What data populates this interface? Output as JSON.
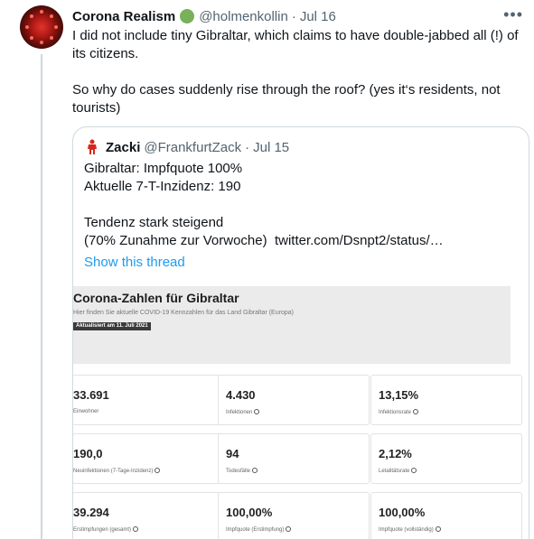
{
  "tweet": {
    "author_name": "Corona Realism",
    "handle": "@holmenkollin",
    "separator": "·",
    "date": "Jul 16",
    "more_icon": "more-icon",
    "paragraph1": "I did not include tiny Gibraltar, which claims to have double-jabbed all (!) of its citizens.",
    "paragraph2": "So why do cases suddenly rise through the roof? (yes it‘s residents, not tourists)"
  },
  "quote": {
    "author_name": "Zacki",
    "handle": "@FrankfurtZack",
    "separator": "·",
    "date": "Jul 15",
    "line1": "Gibraltar: Impfquote 100%",
    "line2": "Aktuelle 7-T-Inzidenz: 190",
    "line3": "Tendenz stark steigend",
    "line4_text": "(70% Zunahme zur Vorwoche)",
    "line4_link": "twitter.com/Dsnpt2/status/…",
    "show_thread": "Show this thread"
  },
  "image": {
    "title": "Corona-Zahlen für Gibraltar",
    "subtitle": "Hier finden Sie aktuelle COVID-19 Kennzahlen für das Land Gibraltar (Europa)",
    "tag": "Aktualisiert am 11. Juli 2021",
    "cards": [
      {
        "value": "33.691",
        "label": "Einwohner",
        "info": false
      },
      {
        "value": "4.430",
        "label": "Infektionen",
        "info": true
      },
      {
        "value": "13,15%",
        "label": "Infektionsrate",
        "info": true
      },
      {
        "value": "190,0",
        "label": "Neuinfektionen (7-Tage-Inzidenz)",
        "info": true
      },
      {
        "value": "94",
        "label": "Todesfälle",
        "info": true
      },
      {
        "value": "2,12%",
        "label": "Letalitätsrate",
        "info": true
      },
      {
        "value": "39.294",
        "label": "Erstimpfungen (gesamt)",
        "info": true
      },
      {
        "value": "100,00%",
        "label": "Impfquote (Erstimpfung)",
        "info": true
      },
      {
        "value": "100,00%",
        "label": "Impfquote (vollständig)",
        "info": true
      }
    ]
  },
  "colors": {
    "link": "#1d9bf0",
    "muted": "#536471",
    "badge": "#78b159",
    "border": "#cfd9de"
  }
}
